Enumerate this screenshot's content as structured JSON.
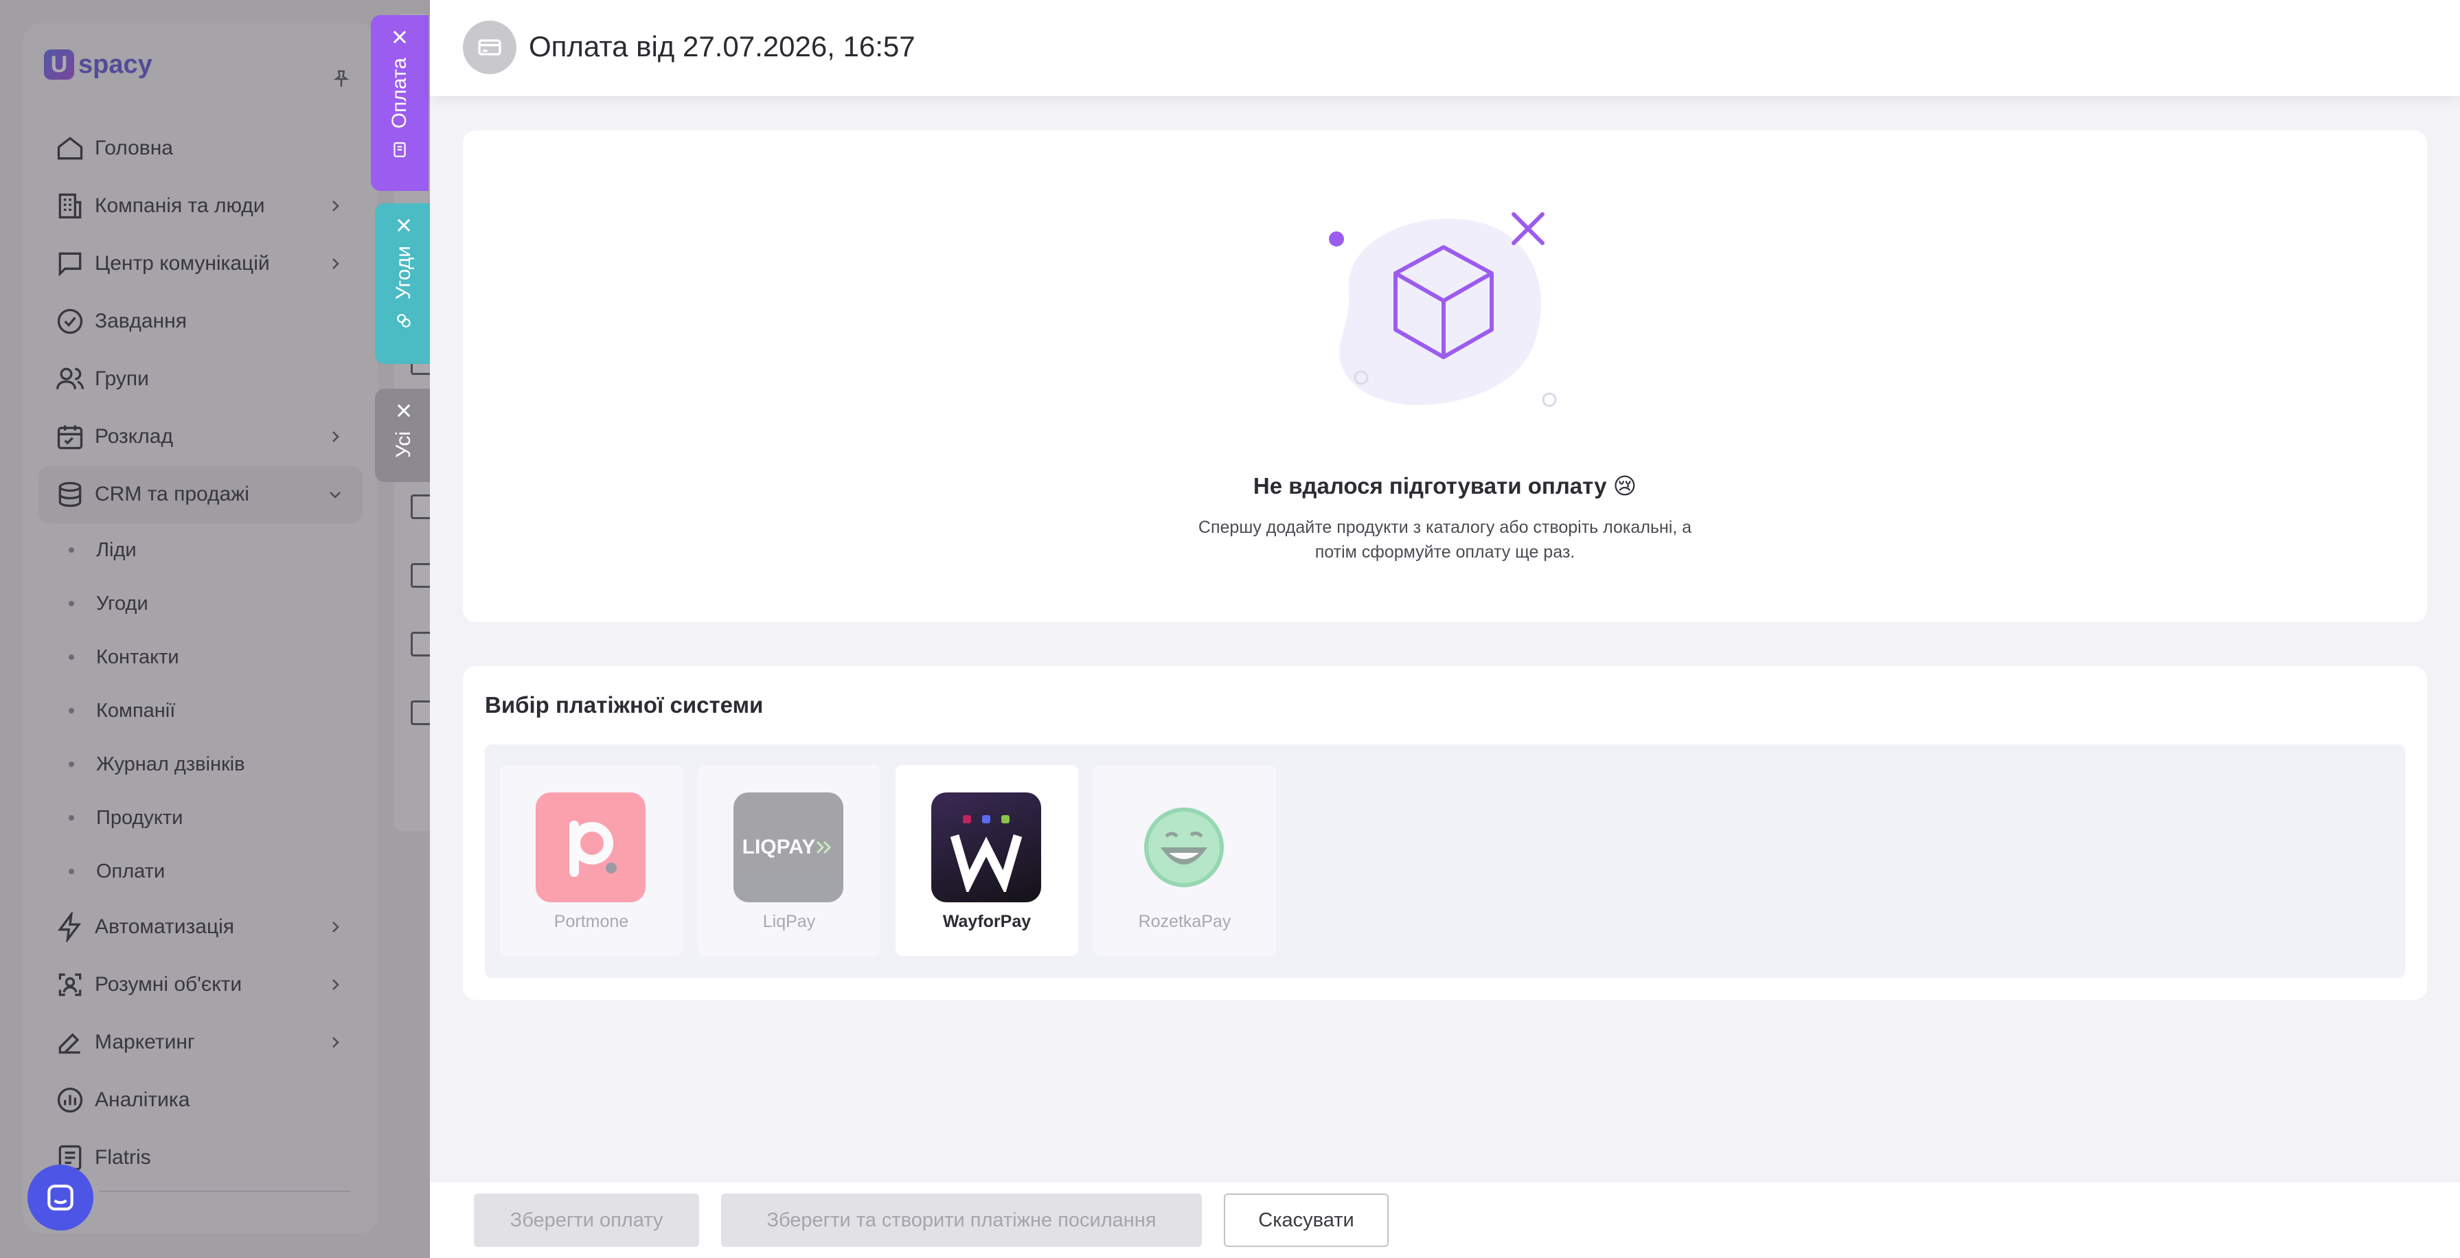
{
  "app": {
    "logo_text": "spacy",
    "logo_letter": "U"
  },
  "sidebar": {
    "items": [
      {
        "label": "Головна"
      },
      {
        "label": "Компанія та люди"
      },
      {
        "label": "Центр комунікацій"
      },
      {
        "label": "Завдання"
      },
      {
        "label": "Групи"
      },
      {
        "label": "Розклад"
      },
      {
        "label": "CRM та продажі"
      }
    ],
    "sub_items": [
      {
        "label": "Ліди"
      },
      {
        "label": "Угоди"
      },
      {
        "label": "Контакти"
      },
      {
        "label": "Компанії"
      },
      {
        "label": "Журнал дзвінків"
      },
      {
        "label": "Продукти"
      },
      {
        "label": "Оплати"
      }
    ],
    "items_after": [
      {
        "label": "Автоматизація"
      },
      {
        "label": "Розумні об'єкти"
      },
      {
        "label": "Маркетинг"
      },
      {
        "label": "Аналітика"
      },
      {
        "label": "Flatris"
      }
    ]
  },
  "side_tabs": [
    {
      "label": "Оплата",
      "color": "#9b5cf0"
    },
    {
      "label": "Угоди",
      "color": "#4bbbc4"
    },
    {
      "label": "Усі",
      "color": "#8c8990"
    }
  ],
  "drawer": {
    "title": "Оплата від 27.07.2026, 16:57",
    "empty": {
      "title": "Не вдалося підготувати оплату 😢",
      "desc_line1": "Спершу додайте продукти з каталогу або створіть локальні, а",
      "desc_line2": "потім сформуйте оплату ще раз."
    },
    "payment": {
      "title": "Вибір платіжної системи",
      "options": [
        {
          "name": "Portmone",
          "selected": false
        },
        {
          "name": "LiqPay",
          "selected": false,
          "logo_text": "LIQPAY"
        },
        {
          "name": "WayforPay",
          "selected": true
        },
        {
          "name": "RozetkaPay",
          "selected": false
        }
      ]
    },
    "footer": {
      "save": "Зберегти оплату",
      "save_link": "Зберегти та створити платіжне посилання",
      "cancel": "Скасувати"
    }
  }
}
